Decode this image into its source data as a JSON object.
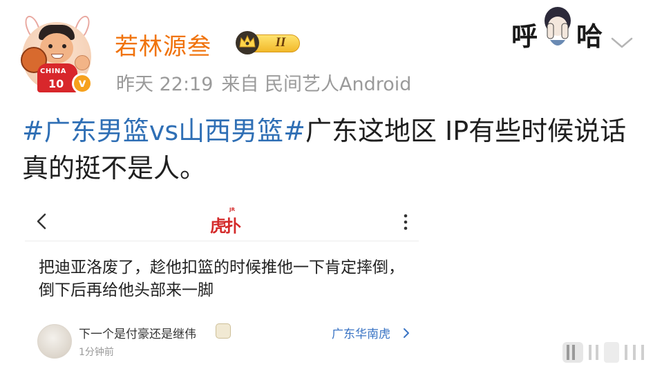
{
  "post": {
    "author": {
      "name": "若林源叁",
      "vip_level": "II",
      "avatar_jersey_text": "CHINA",
      "avatar_jersey_number": "10",
      "verified_mark": "v"
    },
    "meta": {
      "time": "昨天 22:19",
      "source": "来自 民间艺人Android"
    },
    "text": {
      "hashtag": "#广东男篮vs山西男篮#",
      "body": "广东这地区 IP有些时候说话真的挺不是人。"
    },
    "sticker": {
      "left_char": "呼",
      "right_char": "哈"
    }
  },
  "embedded_screenshot": {
    "app_logo": "虎扑",
    "app_logo_sup": "JR",
    "comment_text": "把迪亚洛废了，趁他扣篮的时候推他一下肯定摔倒，倒下后再给他头部来一脚",
    "reply": {
      "username": "下一个是付豪还是继伟",
      "time": "1分钟前",
      "team": "广东华南虎"
    }
  },
  "colors": {
    "username": "#f0730c",
    "hashtag": "#2f6fb5",
    "meta_gray": "#9a9a9a",
    "team_link": "#3a74c4",
    "logo_red": "#d42a2a"
  },
  "icons": {
    "more": "chevron-down-icon",
    "embed_back": "chevron-left-icon",
    "embed_more": "vertical-ellipsis-icon",
    "reply_more": "chevron-right-icon",
    "verified": "verified-badge-icon",
    "vip": "crown-icon"
  }
}
